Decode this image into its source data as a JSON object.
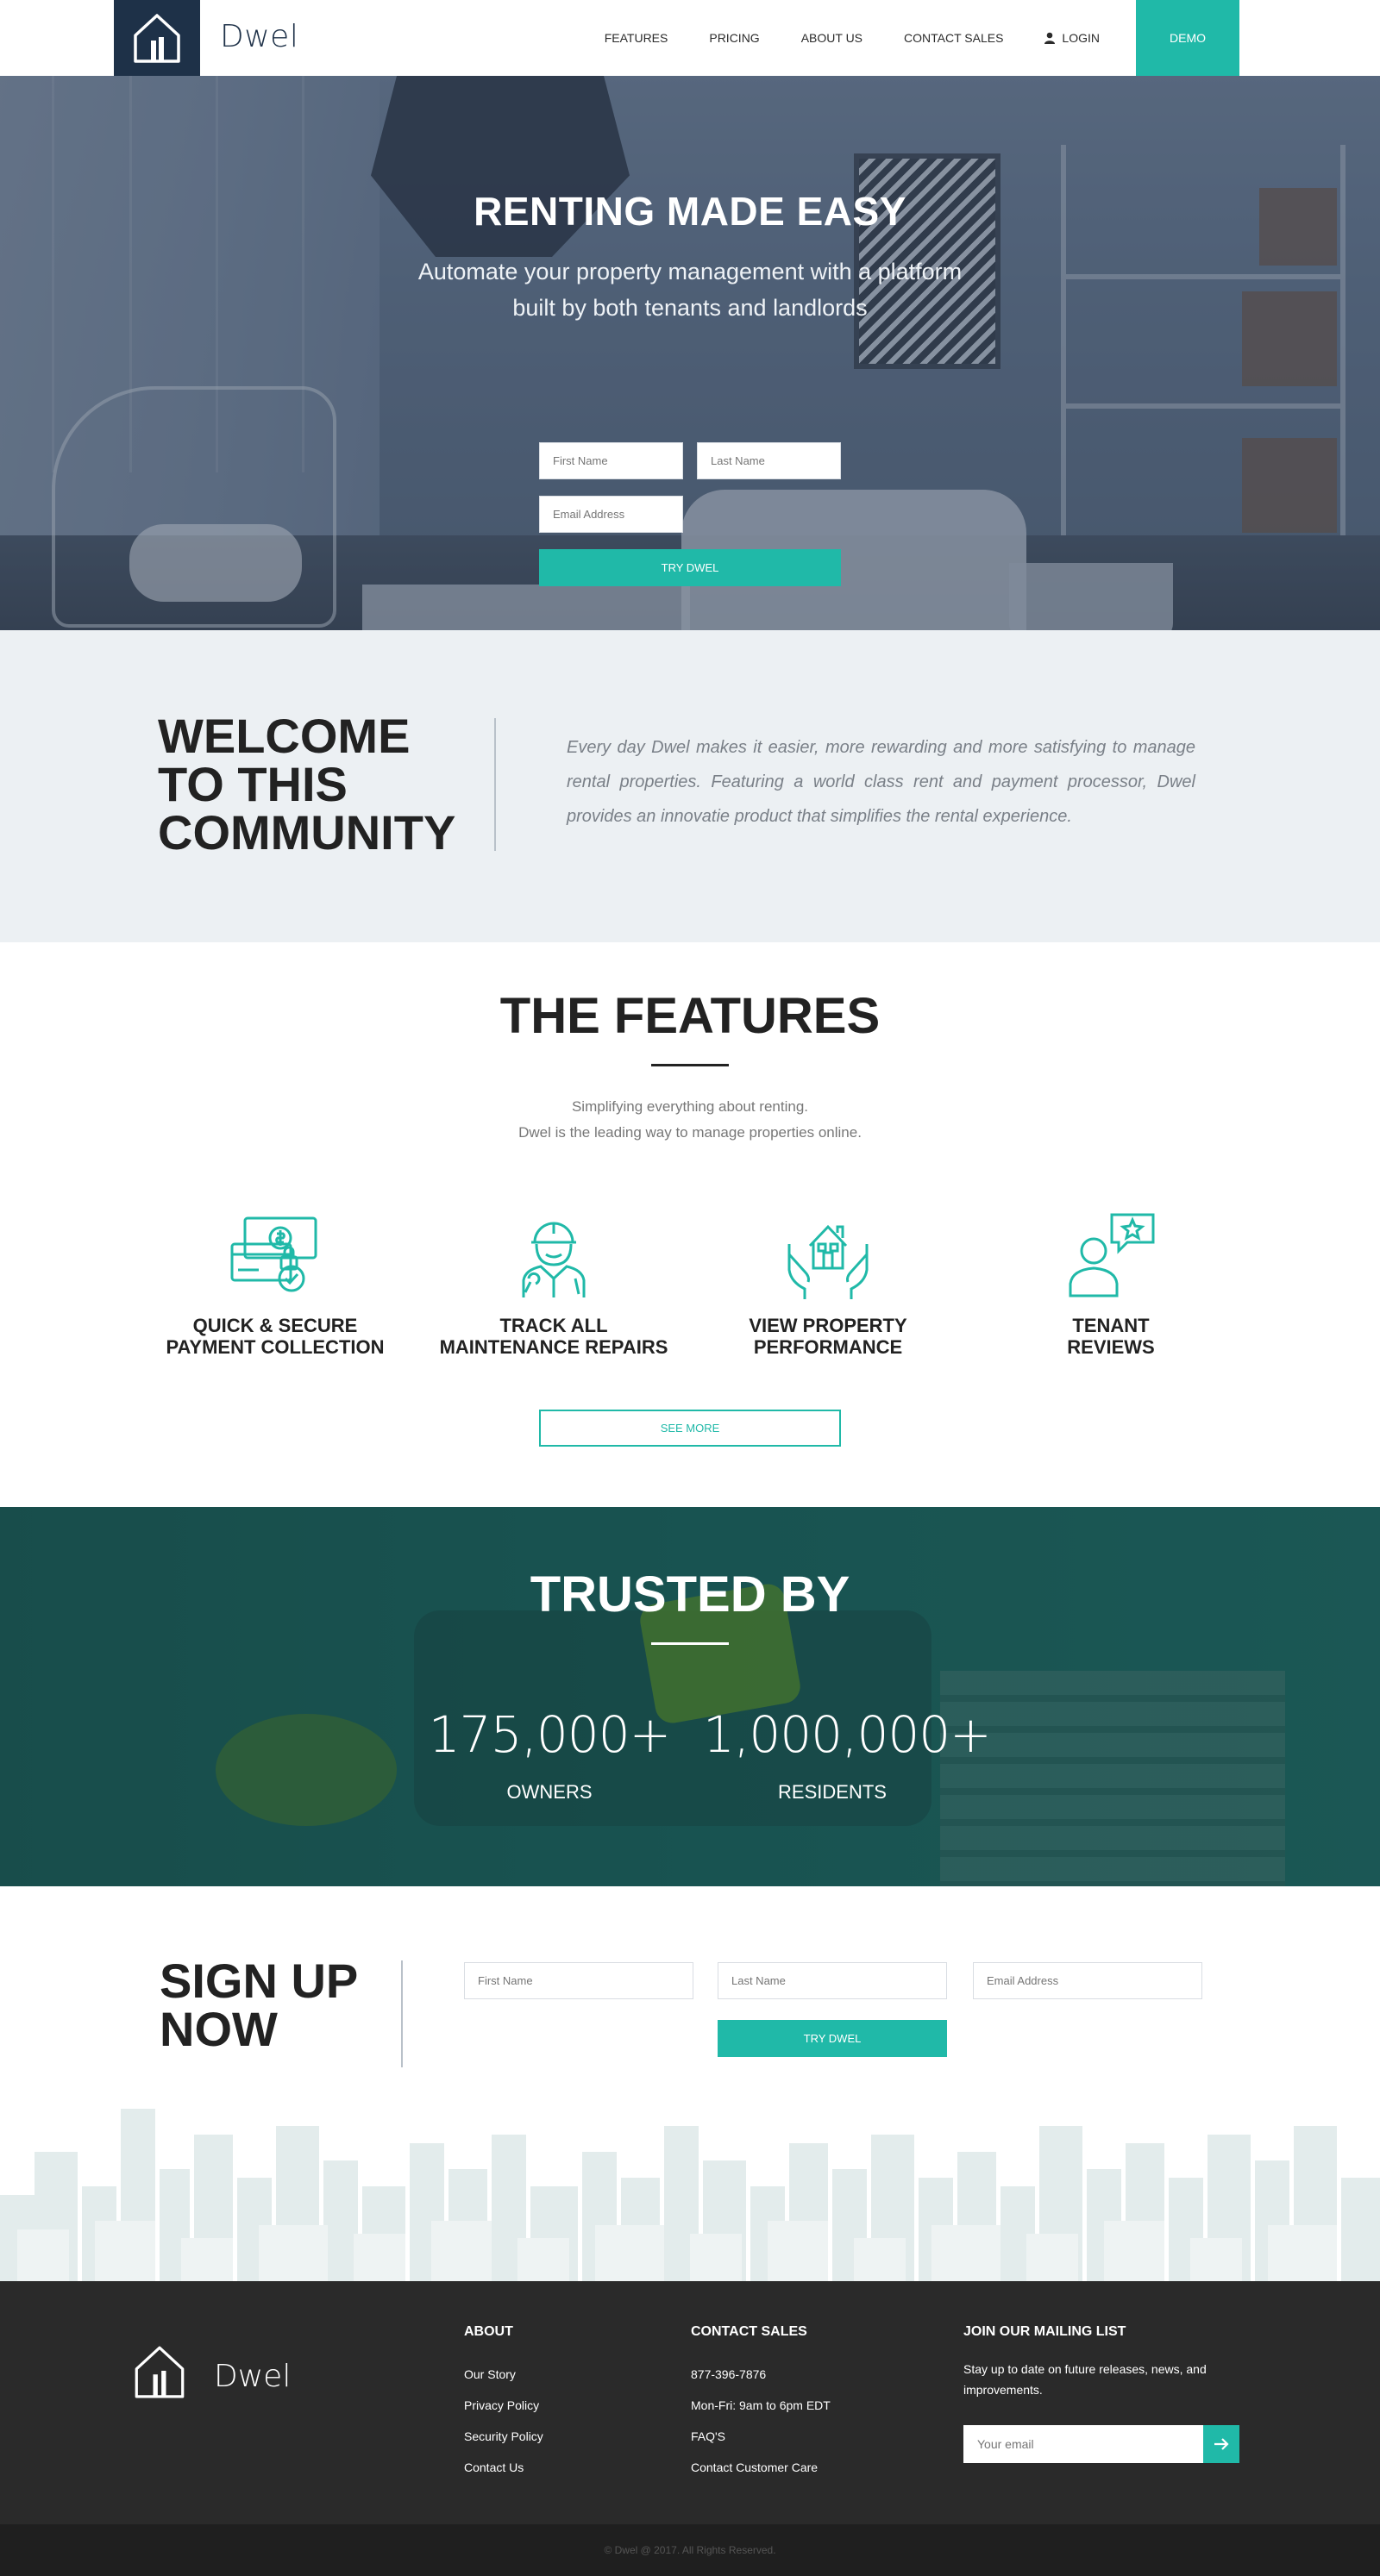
{
  "header": {
    "brand": "Dwel",
    "nav": [
      "FEATURES",
      "PRICING",
      "ABOUT US",
      "CONTACT SALES"
    ],
    "login": "LOGIN",
    "demo": "DEMO"
  },
  "hero": {
    "title": "RENTING MADE EASY",
    "subtitle": "Automate your property management with a platform built by both tenants and landlords",
    "first_name_placeholder": "First Name",
    "last_name_placeholder": "Last Name",
    "email_placeholder": "Email Address",
    "cta": "TRY DWEL"
  },
  "welcome": {
    "title": "WELCOME TO THIS COMMUNITY",
    "text": "Every day Dwel makes it easier, more rewarding and more satisfying to manage rental properties. Featuring a world class rent and payment processor, Dwel provides an innovatie product that simplifies the rental experience."
  },
  "features": {
    "title": "THE FEATURES",
    "sub1": "Simplifying everything about renting.",
    "sub2": "Dwel is the leading way to manage properties online.",
    "items": [
      {
        "label1": "QUICK & SECURE",
        "label2": "PAYMENT COLLECTION",
        "icon": "payment-icon"
      },
      {
        "label1": "TRACK ALL",
        "label2": "MAINTENANCE REPAIRS",
        "icon": "maintenance-worker-icon"
      },
      {
        "label1": "VIEW PROPERTY",
        "label2": "PERFORMANCE",
        "icon": "house-in-hands-icon"
      },
      {
        "label1": "TENANT",
        "label2": "REVIEWS",
        "icon": "tenant-review-icon"
      }
    ],
    "see_more": "SEE MORE"
  },
  "trusted": {
    "title": "TRUSTED BY",
    "stats": [
      {
        "num": "175,000+",
        "label": "OWNERS"
      },
      {
        "num": "1,000,000+",
        "label": "RESIDENTS"
      }
    ]
  },
  "signup": {
    "title_line1": "SIGN UP",
    "title_line2": "NOW",
    "first_name_placeholder": "First Name",
    "last_name_placeholder": "Last Name",
    "email_placeholder": "Email Address",
    "cta": "TRY DWEL"
  },
  "footer": {
    "brand": "Dwel",
    "about": {
      "heading": "ABOUT",
      "links": [
        "Our Story",
        "Privacy Policy",
        "Security Policy",
        "Contact Us"
      ]
    },
    "sales": {
      "heading": "CONTACT SALES",
      "lines": [
        "877-396-7876",
        "Mon-Fri: 9am to 6pm EDT",
        "FAQ'S",
        "Contact Customer Care"
      ]
    },
    "mailing": {
      "heading": "JOIN OUR MAILING LIST",
      "text": "Stay up to date on future releases, news, and improvements.",
      "placeholder": "Your email"
    },
    "copyright": "© Dwel @ 2017. All Rights Reserved."
  },
  "colors": {
    "accent": "#20b9a8",
    "navy": "#1e3148",
    "footer": "#2a2a2a"
  }
}
